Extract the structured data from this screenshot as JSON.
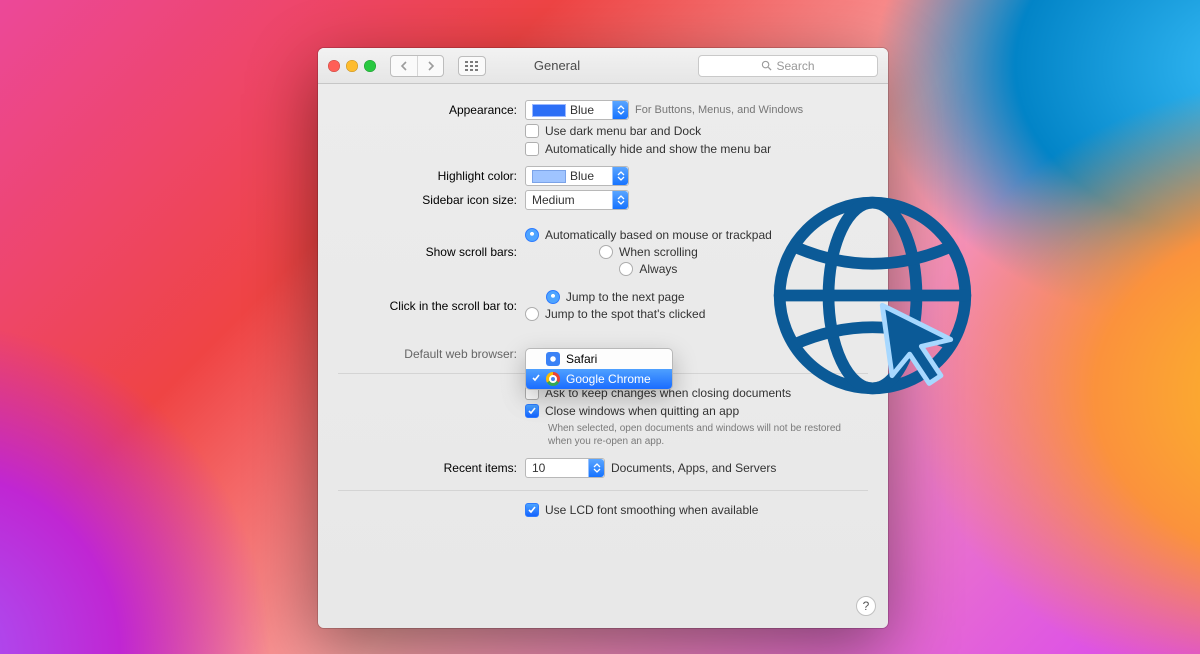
{
  "window": {
    "title": "General",
    "search_placeholder": "Search"
  },
  "appearance": {
    "label": "Appearance:",
    "value": "Blue",
    "hint": "For Buttons, Menus, and Windows",
    "dark_menu": "Use dark menu bar and Dock",
    "auto_hide": "Automatically hide and show the menu bar"
  },
  "highlight": {
    "label": "Highlight color:",
    "value": "Blue"
  },
  "sidebar_size": {
    "label": "Sidebar icon size:",
    "value": "Medium"
  },
  "scrollbars": {
    "label": "Show scroll bars:",
    "opts": [
      "Automatically based on mouse or trackpad",
      "When scrolling",
      "Always"
    ],
    "selected": 0
  },
  "scrollclick": {
    "label": "Click in the scroll bar to:",
    "opts": [
      "Jump to the next page",
      "Jump to the spot that's clicked"
    ],
    "selected": 0
  },
  "browser": {
    "label": "Default web browser:",
    "menu": [
      "Safari",
      "Google Chrome"
    ],
    "selected": 1
  },
  "docs": {
    "ask_keep": "Ask to keep changes when closing documents",
    "close_quit": "Close windows when quitting an app",
    "note": "When selected, open documents and windows will not be restored when you re-open an app."
  },
  "recent": {
    "label": "Recent items:",
    "value": "10",
    "suffix": "Documents, Apps, and Servers"
  },
  "lcd": "Use LCD font smoothing when available",
  "help": "?"
}
